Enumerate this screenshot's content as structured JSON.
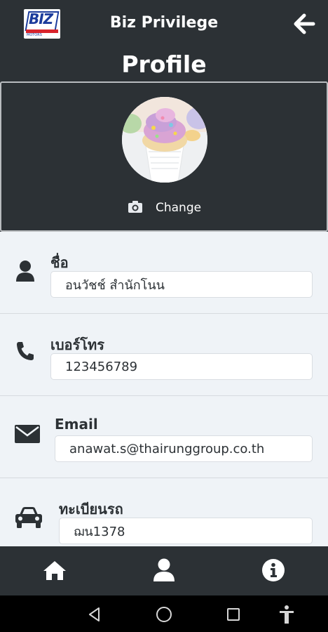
{
  "header": {
    "logo_text": "BIZ",
    "logo_sub": "MOTORS",
    "app_title": "Biz Privilege",
    "back_icon": "arrow-left-icon",
    "page_title": "Profile"
  },
  "photo": {
    "avatar_desc": "cupcake-avatar",
    "change_icon": "camera-icon",
    "change_label": "Change"
  },
  "fields": {
    "name": {
      "icon": "user-icon",
      "label": "ชื่อ",
      "value": "อนวัชช์ สำนักโนน"
    },
    "phone": {
      "icon": "phone-icon",
      "label": "เบอร์โทร",
      "value": "123456789"
    },
    "email": {
      "icon": "envelope-icon",
      "label": "Email",
      "value": "anawat.s@thairunggroup.co.th"
    },
    "plate": {
      "icon": "car-icon",
      "label": "ทะเบียนรถ",
      "value": "ฌน1378"
    }
  },
  "tabs": [
    "home-icon",
    "user-icon",
    "info-icon"
  ],
  "system_nav": [
    "back-triangle-icon",
    "home-circle-icon",
    "recents-square-icon",
    "accessibility-icon"
  ],
  "colors": {
    "header_bg": "#2c3135",
    "form_bg": "#eff3f7",
    "input_bg": "#ffffff",
    "logo_blue": "#1c3c9c",
    "logo_red": "#d8242c"
  }
}
